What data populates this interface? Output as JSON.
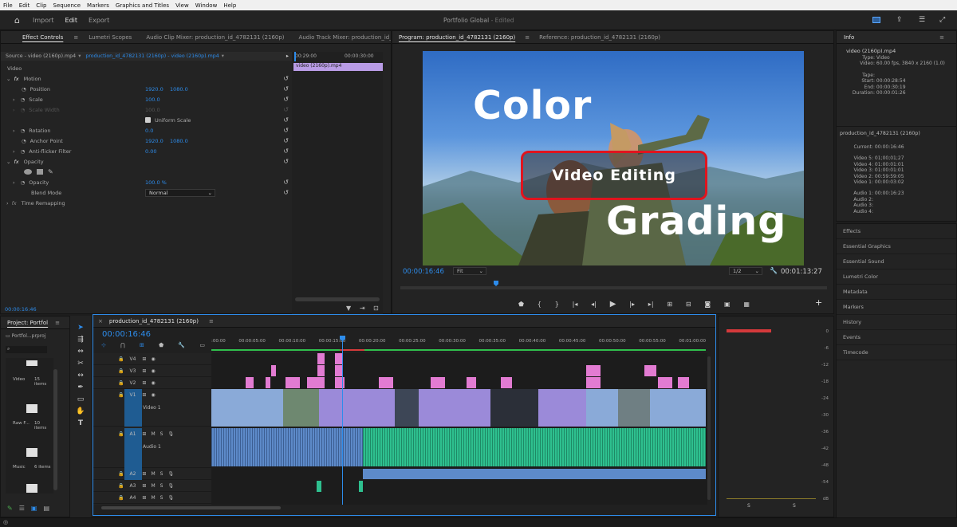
{
  "menu": [
    "File",
    "Edit",
    "Clip",
    "Sequence",
    "Markers",
    "Graphics and Titles",
    "View",
    "Window",
    "Help"
  ],
  "workspaces": {
    "import": "Import",
    "edit": "Edit",
    "export": "Export"
  },
  "project_title": "Portfolio Global",
  "edited": "- Edited",
  "source_tabs": {
    "effect_controls": "Effect Controls",
    "lumetri_scopes": "Lumetri Scopes",
    "audio_clip_mixer": "Audio Clip Mixer: production_id_4782131 (2160p)",
    "audio_track_mixer": "Audio Track Mixer: production_id_47"
  },
  "effect_controls": {
    "source": "Source - video (2160p).mp4",
    "sequence_clip": "production_id_4782131 (2160p) - video (2160p).mp4",
    "time_start": "00:29:00",
    "time_end": "00:00:30:00",
    "clip_label": "video (2160p).mp4",
    "video_header": "Video",
    "motion": "Motion",
    "position_label": "Position",
    "position_x": "1920.0",
    "position_y": "1080.0",
    "scale_label": "Scale",
    "scale_value": "100.0",
    "scale_width_label": "Scale Width",
    "scale_width_value": "100.0",
    "uniform_scale": "Uniform Scale",
    "rotation_label": "Rotation",
    "rotation_value": "0.0",
    "anchor_label": "Anchor Point",
    "anchor_x": "1920.0",
    "anchor_y": "1080.0",
    "antiflicker_label": "Anti-flicker Filter",
    "antiflicker_value": "0.00",
    "opacity_header": "Opacity",
    "opacity_label": "Opacity",
    "opacity_value": "100.0 %",
    "blend_label": "Blend Mode",
    "blend_value": "Normal",
    "time_remap": "Time Remapping",
    "timecode": "00:00:16:46"
  },
  "program": {
    "tab": "Program: production_id_4782131 (2160p)",
    "ref_tab": "Reference: production_id_4782131 (2160p)",
    "title_color": "Color",
    "title_video": "Video Editing",
    "title_grading": "Grading",
    "timecode": "00:00:16:46",
    "fit": "Fit",
    "resolution": "1/2",
    "duration": "00:01:13:27"
  },
  "info": {
    "title": "Info",
    "file": "video (2160p).mp4",
    "rows": [
      [
        "Type:",
        "Video"
      ],
      [
        "Video:",
        "60.00 fps, 3840 x 2160 (1.0)"
      ],
      [
        "",
        ""
      ],
      [
        "Tape:",
        ""
      ],
      [
        "Start:",
        "00:00:28:54"
      ],
      [
        "End:",
        "00:00:30:19"
      ],
      [
        "Duration:",
        "00:00:01:26"
      ]
    ],
    "seq": "production_id_4782131 (2160p)",
    "seq_rows": [
      [
        "Current:",
        "00:00:16:46"
      ],
      [
        "",
        ""
      ],
      [
        "Video 5:",
        "01;00;01;27"
      ],
      [
        "Video 4:",
        "01:00:01:01"
      ],
      [
        "Video 3:",
        "01:00:01:01"
      ],
      [
        "Video 2:",
        "00:59:59:05"
      ],
      [
        "Video 1:",
        "00:00:03:02"
      ],
      [
        "",
        ""
      ],
      [
        "Audio 1:",
        "00:00:16:23"
      ],
      [
        "Audio 2:",
        ""
      ],
      [
        "Audio 3:",
        ""
      ],
      [
        "Audio 4:",
        ""
      ]
    ]
  },
  "side_panels": [
    "Effects",
    "Essential Graphics",
    "Essential Sound",
    "Lumetri Color",
    "Metadata",
    "Markers",
    "History",
    "Events",
    "Timecode"
  ],
  "project": {
    "tab": "Project: Portfol",
    "file": "Portfol...prproj",
    "bins": [
      {
        "name": "Video",
        "count": "15 items"
      },
      {
        "name": "Raw F...",
        "count": "10 items"
      },
      {
        "name": "Music",
        "count": "6 items"
      }
    ]
  },
  "timeline": {
    "tab": "production_id_4782131 (2160p)",
    "timecode": "00:00:16:46",
    "ruler": [
      ":00:00",
      "00:00:05:00",
      "00:00:10:00",
      "00:00:15:00",
      "00:00:20:00",
      "00:00:25:00",
      "00:00:30:00",
      "00:00:35:00",
      "00:00:40:00",
      "00:00:45:00",
      "00:00:50:00",
      "00:00:55:00",
      "00:01:00:00"
    ],
    "video_tracks": [
      "V4",
      "V3",
      "V2",
      "V1"
    ],
    "video1": "Video 1",
    "audio_tracks": [
      "A1",
      "A2",
      "A3",
      "A4"
    ],
    "audio1": "Audio 1"
  },
  "meters": {
    "ticks": [
      "0",
      "-6",
      "-12",
      "-18",
      "-24",
      "-30",
      "-36",
      "-42",
      "-48",
      "-54",
      "dB"
    ],
    "solo": "S"
  },
  "colors": {
    "accent": "#2d8ceb",
    "video_clip": "#9b8ad9",
    "v1_clip": "#8aaad8",
    "pink_clip": "#e27bd2",
    "audio_green": "#2ec08f",
    "audio_blue": "#5d8ac9",
    "title_box": "#e0141e"
  }
}
